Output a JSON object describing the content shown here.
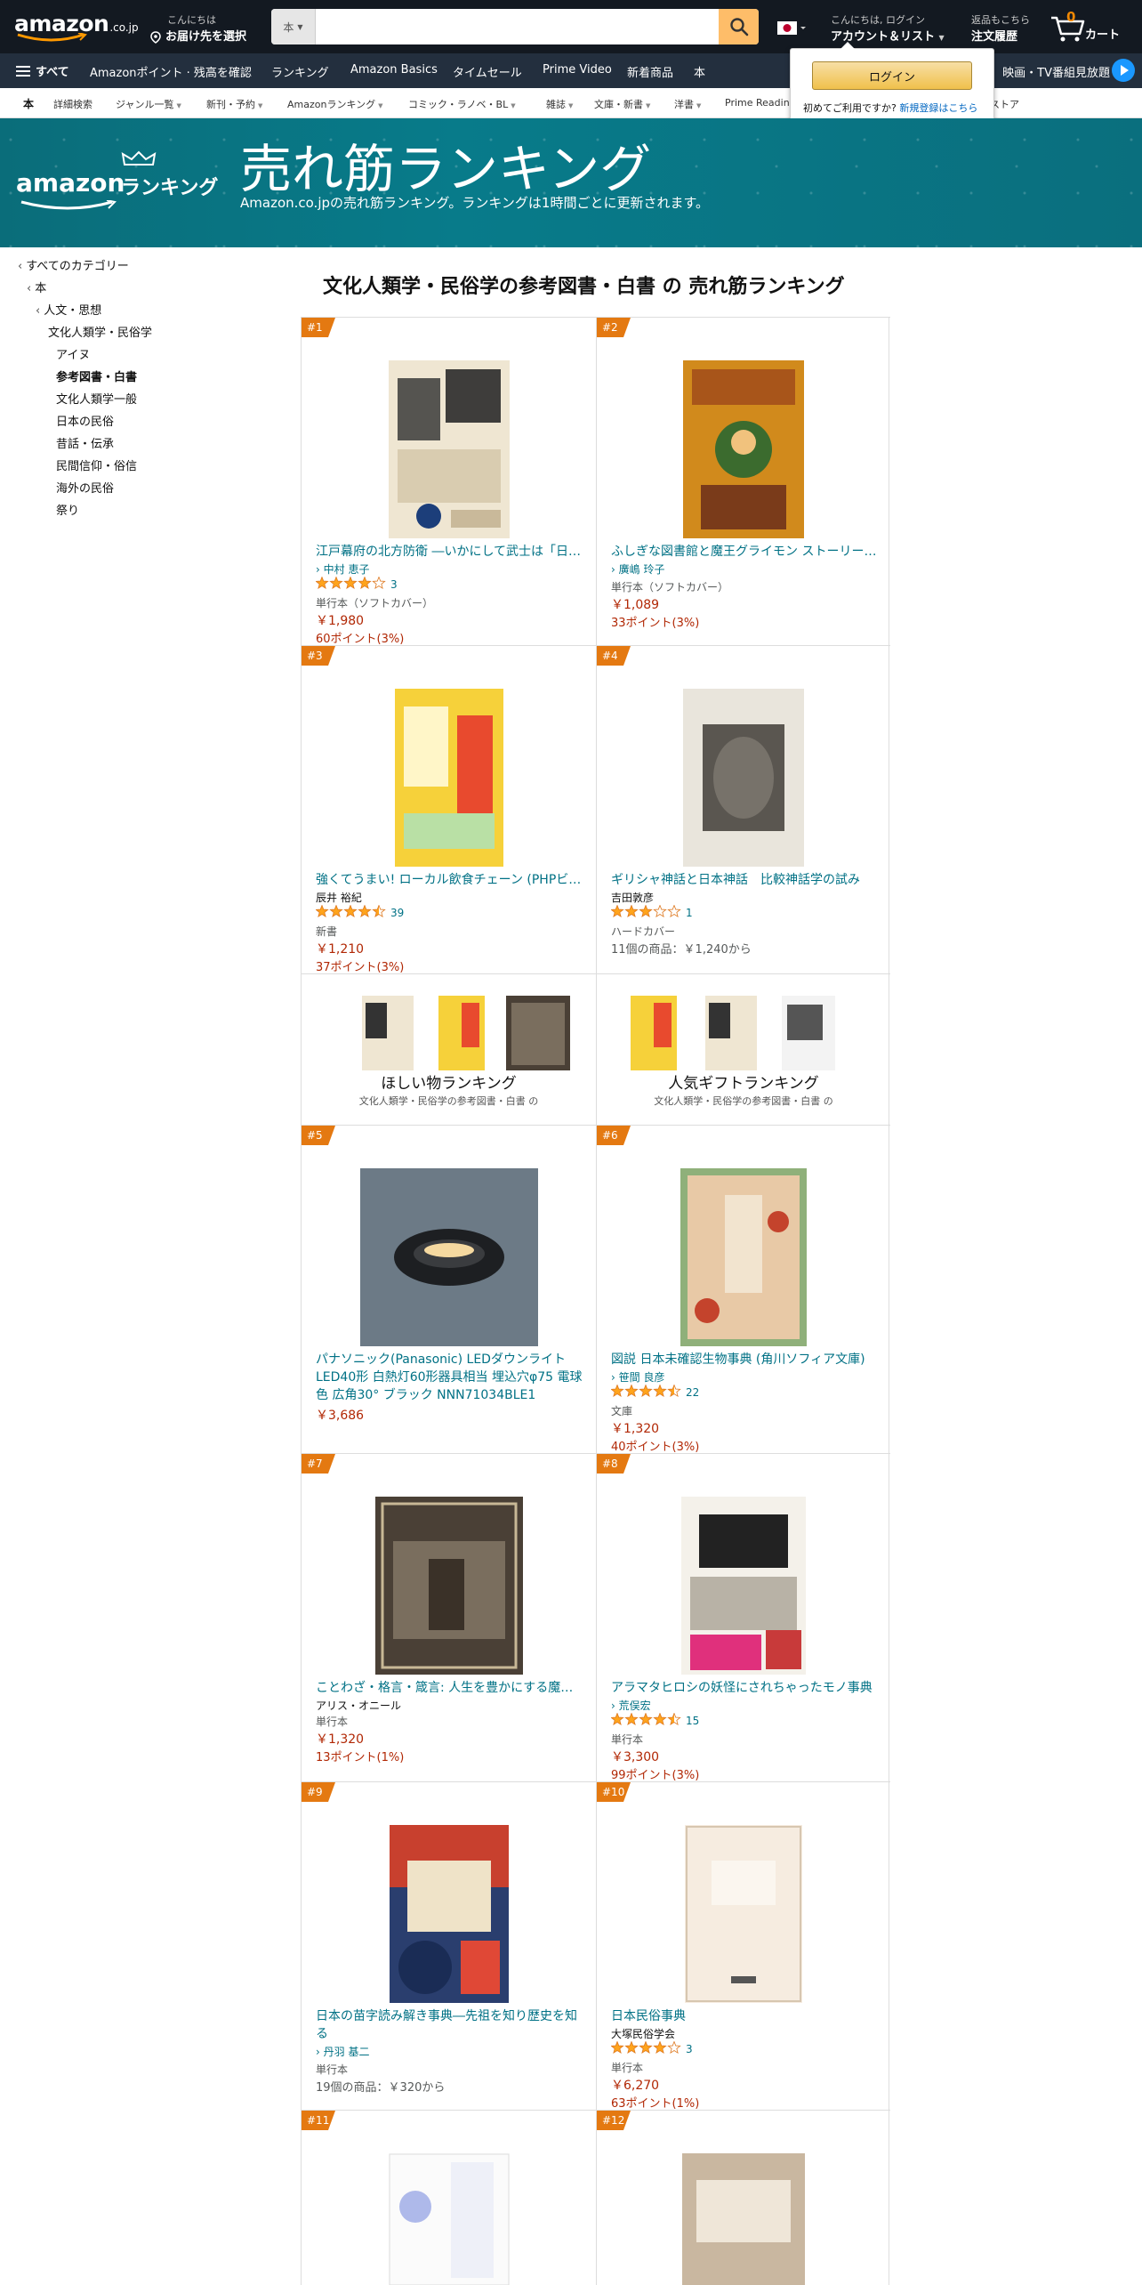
{
  "header": {
    "logo_word": "amazon",
    "logo_tld": ".co.jp",
    "deliver_line1": "こんにちは",
    "deliver_line2": "お届け先を選択",
    "search_category": "本",
    "search_placeholder": "",
    "account_line1": "こんにちは, ログイン",
    "account_line2": "アカウント＆リスト",
    "orders_line1": "返品もこちら",
    "orders_line2": "注文履歴",
    "cart_count": "0",
    "cart_label": "カート"
  },
  "main_nav": {
    "all_label": "すべて",
    "items": [
      "Amazonポイント · 残高を確認",
      "ランキング",
      "Amazon Basics",
      "タイムセール",
      "Prime Video",
      "新着商品",
      "本"
    ],
    "right_label": "映画・TV番組見放題"
  },
  "sub_nav": {
    "items": [
      "本",
      "詳細検索",
      "ジャンル一覧",
      "新刊・予約",
      "Amazonランキング",
      "コミック・ラノベ・BL",
      "雑誌",
      "文庫・新書",
      "洋書",
      "Prime Reading",
      "本ストア"
    ]
  },
  "login_popover": {
    "button_label": "ログイン",
    "new_text": "初めてご利用ですか?",
    "new_link": "新規登録はこちら"
  },
  "banner": {
    "logo_word": "amazon",
    "logo_rank": "ランキング",
    "title": "売れ筋ランキング",
    "subtitle": "Amazon.co.jpの売れ筋ランキング。ランキングは1時間ごとに更新されます。"
  },
  "sidebar": {
    "nodes": [
      "すべてのカテゴリー",
      "本",
      "人文・思想",
      "文化人類学・民俗学",
      "アイヌ",
      "参考図書・白書",
      "文化人類学一般",
      "日本の民俗",
      "昔話・伝承",
      "民間信仰・俗信",
      "海外の民俗",
      "祭り"
    ]
  },
  "main": {
    "heading": "文化人類学・民俗学の参考図書・白書 の 売れ筋ランキング",
    "products": [
      {
        "rank": "#1",
        "title": "江戸幕府の北方防衛 ―いかにして武士は「日…",
        "author": "中村 恵子",
        "author_link": true,
        "rating": 4.0,
        "reviews": "3",
        "format": "単行本（ソフトカバー）",
        "price": "￥1,980",
        "points": "60ポイント(3%)"
      },
      {
        "rank": "#2",
        "title": "ふしぎな図書館と魔王グライモン ストーリー…",
        "author": "廣嶋 玲子",
        "author_link": true,
        "rating": null,
        "reviews": "",
        "format": "単行本（ソフトカバー）",
        "price": "￥1,089",
        "points": "33ポイント(3%)"
      },
      {
        "rank": "#3",
        "title": "強くてうまい! ローカル飲食チェーン (PHPビ…",
        "author": "辰井 裕紀",
        "author_link": false,
        "rating": 4.5,
        "reviews": "39",
        "format": "新書",
        "price": "￥1,210",
        "points": "37ポイント(3%)"
      },
      {
        "rank": "#4",
        "title": "ギリシャ神話と日本神話　比較神話学の試み",
        "author": "吉田敦彦",
        "author_link": false,
        "rating": 3.0,
        "reviews": "1",
        "format": "ハードカバー",
        "other": "11個の商品：￥1,240から"
      },
      {
        "rank": "#5",
        "title": "パナソニック(Panasonic) LEDダウンライト LED40形 白熱灯60形器具相当 埋込穴φ75 電球色 広角30° ブラック NNN71034BLE1",
        "price": "￥3,686"
      },
      {
        "rank": "#6",
        "title": "図説 日本未確認生物事典 (角川ソフィア文庫)",
        "author": "笹間 良彦",
        "author_link": true,
        "rating": 4.5,
        "reviews": "22",
        "format": "文庫",
        "price": "￥1,320",
        "points": "40ポイント(3%)"
      },
      {
        "rank": "#7",
        "title": "ことわざ・格言・箴言: 人生を豊かにする魔…",
        "author": "アリス・オニール",
        "author_link": false,
        "format": "単行本",
        "price": "￥1,320",
        "points": "13ポイント(1%)"
      },
      {
        "rank": "#8",
        "title": "アラマタヒロシの妖怪にされちゃったモノ事典",
        "author": "荒俣宏",
        "author_link": true,
        "rating": 4.5,
        "reviews": "15",
        "format": "単行本",
        "price": "￥3,300",
        "points": "99ポイント(3%)"
      },
      {
        "rank": "#9",
        "title": "日本の苗字読み解き事典―先祖を知り歴史を知る",
        "author": "丹羽 基二",
        "author_link": true,
        "format": "単行本",
        "other": "19個の商品：￥320から"
      },
      {
        "rank": "#10",
        "title": "日本民俗事典",
        "author": "大塚民俗学会",
        "author_link": false,
        "rating": 4.0,
        "reviews": "3",
        "format": "単行本",
        "price": "￥6,270",
        "points": "63ポイント(1%)"
      },
      {
        "rank": "#11"
      },
      {
        "rank": "#12"
      }
    ],
    "promos": [
      {
        "title": "ほしい物ランキング",
        "subtitle": "文化人類学・民俗学の参考図書・白書 の"
      },
      {
        "title": "人気ギフトランキング",
        "subtitle": "文化人類学・民俗学の参考図書・白書 の"
      }
    ]
  },
  "colors": {
    "nav_dark": "#131921",
    "nav_mid": "#232f3e",
    "search_button": "#febd69",
    "banner": "#087b8a",
    "link": "#007185",
    "price": "#b12704",
    "badge": "#e47911",
    "star": "#ffa41c"
  }
}
